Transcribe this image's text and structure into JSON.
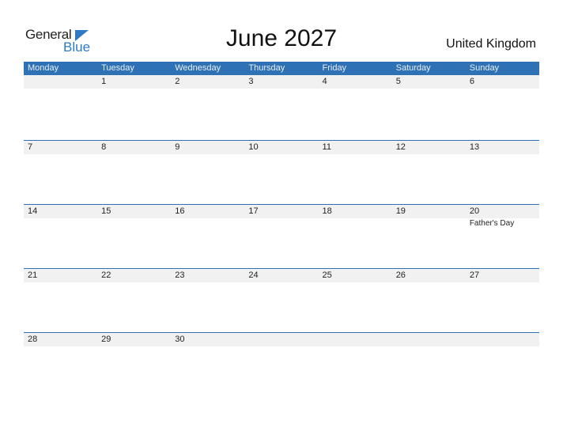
{
  "logo": {
    "general": "General",
    "blue": "Blue",
    "accent": "#2e7bc4"
  },
  "title": "June 2027",
  "country": "United Kingdom",
  "header_color": "#2e72b5",
  "weekdays": [
    "Monday",
    "Tuesday",
    "Wednesday",
    "Thursday",
    "Friday",
    "Saturday",
    "Sunday"
  ],
  "weeks": [
    [
      "",
      "1",
      "2",
      "3",
      "4",
      "5",
      "6"
    ],
    [
      "7",
      "8",
      "9",
      "10",
      "11",
      "12",
      "13"
    ],
    [
      "14",
      "15",
      "16",
      "17",
      "18",
      "19",
      "20"
    ],
    [
      "21",
      "22",
      "23",
      "24",
      "25",
      "26",
      "27"
    ],
    [
      "28",
      "29",
      "30",
      "",
      "",
      "",
      ""
    ]
  ],
  "events": [
    {
      "week": 2,
      "day": 6,
      "label": "Father's Day"
    }
  ]
}
